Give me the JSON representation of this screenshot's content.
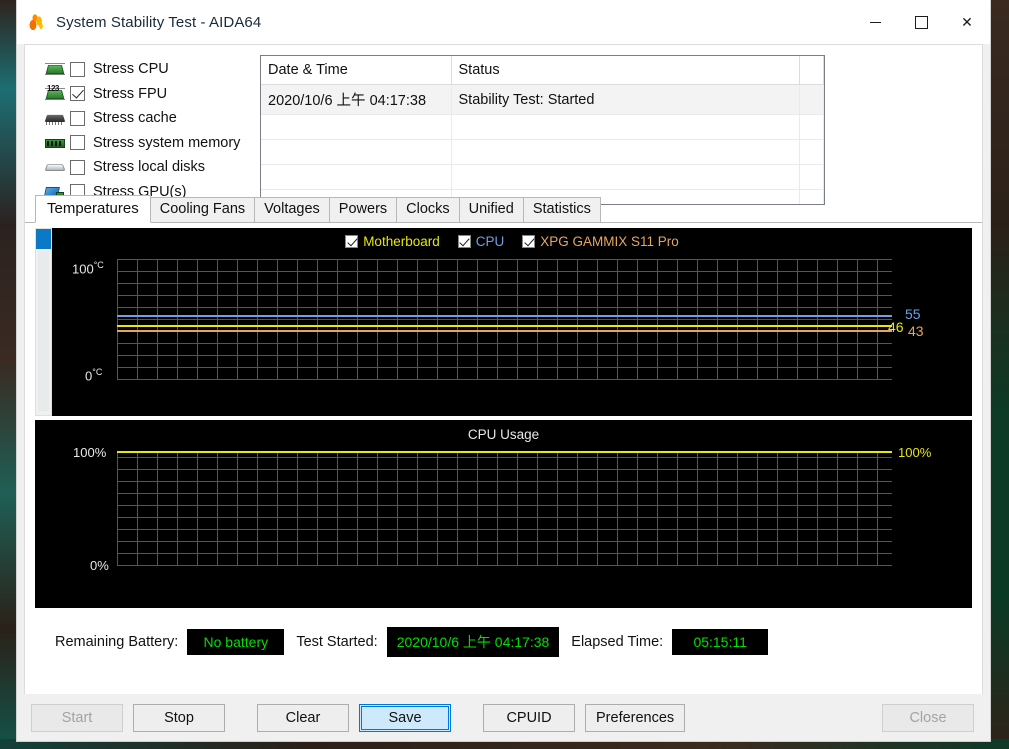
{
  "window": {
    "title": "System Stability Test - AIDA64",
    "app_icon": "flame-icon",
    "minimize_label": "",
    "maximize_label": "",
    "close_label": ""
  },
  "stress_options": [
    {
      "icon": "cpu-chip-icon",
      "label": "Stress CPU",
      "checked": false
    },
    {
      "icon": "fpu-chip-icon",
      "label": "Stress FPU",
      "checked": true
    },
    {
      "icon": "cache-chip-icon",
      "label": "Stress cache",
      "checked": false
    },
    {
      "icon": "memory-stick-icon",
      "label": "Stress system memory",
      "checked": false
    },
    {
      "icon": "disk-icon",
      "label": "Stress local disks",
      "checked": false
    },
    {
      "icon": "gpu-card-icon",
      "label": "Stress GPU(s)",
      "checked": false
    }
  ],
  "log": {
    "columns": [
      "Date & Time",
      "Status",
      ""
    ],
    "rows": [
      [
        "2020/10/6 上午 04:17:38",
        "Stability Test: Started",
        ""
      ]
    ],
    "empty_row_count": 4
  },
  "tabs": [
    {
      "label": "Temperatures",
      "active": true
    },
    {
      "label": "Cooling Fans",
      "active": false
    },
    {
      "label": "Voltages",
      "active": false
    },
    {
      "label": "Powers",
      "active": false
    },
    {
      "label": "Clocks",
      "active": false
    },
    {
      "label": "Unified",
      "active": false
    },
    {
      "label": "Statistics",
      "active": false
    }
  ],
  "chart_data": [
    {
      "type": "line",
      "name": "temperatures-chart",
      "title": "",
      "ylabel": "",
      "ytick_top": "100",
      "ytick_top_unit": "°C",
      "ytick_bottom": "0",
      "ytick_bottom_unit": "°C",
      "ylim": [
        0,
        100
      ],
      "grid": true,
      "grid_color": "#0a8a0a",
      "background": "#000000",
      "legend_position": "top-center",
      "series": [
        {
          "name": "Motherboard",
          "color": "#e8e800",
          "current_value": 46,
          "values": [
            46,
            46,
            46,
            46,
            46,
            46,
            46,
            46,
            46,
            46,
            46,
            46,
            46,
            46,
            46,
            46,
            46,
            46,
            46,
            46,
            46,
            46,
            46,
            46,
            46,
            46,
            46,
            46,
            46,
            46,
            46,
            46,
            46,
            46,
            46,
            46,
            46,
            46,
            46,
            46
          ]
        },
        {
          "name": "CPU",
          "color": "#6f9fe8",
          "current_value": 55,
          "values": [
            55,
            55,
            55,
            55,
            55,
            55,
            55,
            55,
            55,
            55,
            55,
            55,
            55,
            55,
            55,
            55,
            55,
            55,
            55,
            55,
            55,
            55,
            55,
            55,
            55,
            55,
            55,
            55,
            55,
            55,
            55,
            55,
            55,
            55,
            55,
            55,
            55,
            55,
            55,
            55
          ]
        },
        {
          "name": "XPG GAMMIX S11 Pro",
          "color": "#e8a55a",
          "current_value": 43,
          "values": [
            43,
            43,
            43,
            43,
            43,
            43,
            43,
            43,
            43,
            43,
            43,
            44,
            43,
            43,
            43,
            43,
            43,
            43,
            43,
            43,
            43,
            43,
            43,
            44,
            43,
            43,
            43,
            43,
            43,
            43,
            43,
            43,
            43,
            43,
            44,
            43,
            43,
            43,
            43,
            43
          ]
        }
      ],
      "value_labels": [
        {
          "text": "55",
          "color": "#6f9fe8"
        },
        {
          "text": "46",
          "color": "#e8e800"
        },
        {
          "text": "43",
          "color": "#e8a55a"
        }
      ]
    },
    {
      "type": "line",
      "name": "cpu-usage-chart",
      "title": "CPU Usage",
      "ytick_top_left": "100%",
      "ytick_top_right": "100%",
      "ytick_bottom": "0%",
      "ylim": [
        0,
        100
      ],
      "grid": true,
      "grid_color": "#0a8a0a",
      "background": "#000000",
      "series": [
        {
          "name": "CPU Usage",
          "color": "#e8e800",
          "current_value": 100,
          "values": [
            100,
            100,
            100,
            100,
            100,
            100,
            100,
            100,
            100,
            100,
            100,
            100,
            100,
            100,
            100,
            100,
            100,
            100,
            100,
            100,
            100,
            100,
            100,
            100,
            100,
            100,
            100,
            100,
            100,
            100,
            100,
            100,
            100,
            100,
            100,
            100,
            100,
            100,
            100,
            100
          ]
        }
      ]
    }
  ],
  "legend": [
    {
      "label": "Motherboard",
      "color": "#e8e800",
      "checked": true
    },
    {
      "label": "CPU",
      "color": "#6f9fe8",
      "checked": true
    },
    {
      "label": "XPG GAMMIX S11 Pro",
      "color": "#e8a55a",
      "checked": true
    }
  ],
  "status": {
    "battery_label": "Remaining Battery:",
    "battery_value": "No battery",
    "started_label": "Test Started:",
    "started_value": "2020/10/6 上午 04:17:38",
    "elapsed_label": "Elapsed Time:",
    "elapsed_value": "05:15:11",
    "value_color": "#00e000"
  },
  "buttons": [
    {
      "label": "Start",
      "state": "disabled"
    },
    {
      "label": "Stop",
      "state": "normal"
    },
    {
      "label": "Clear",
      "state": "normal"
    },
    {
      "label": "Save",
      "state": "focused"
    },
    {
      "label": "CPUID",
      "state": "normal"
    },
    {
      "label": "Preferences",
      "state": "normal"
    },
    {
      "label": "Close",
      "state": "disabled"
    }
  ]
}
